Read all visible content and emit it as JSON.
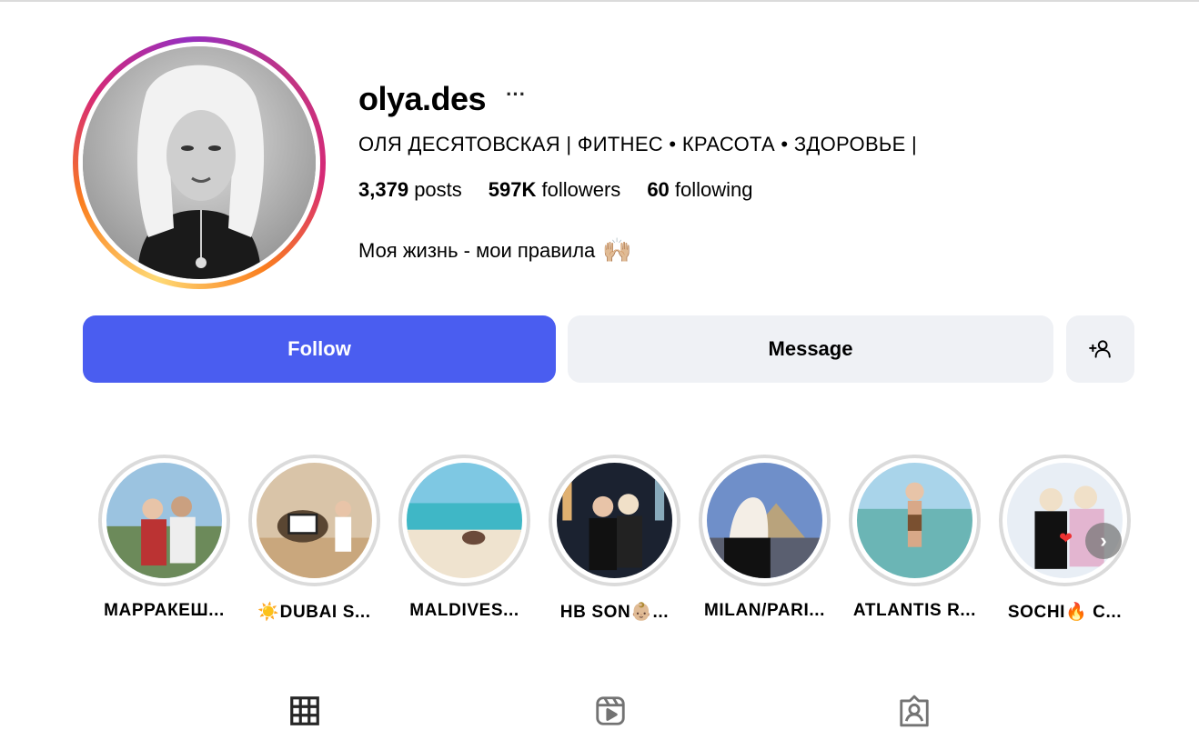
{
  "profile": {
    "username": "olya.des",
    "more_label": "···",
    "full_name": "ОЛЯ ДЕСЯТОВСКАЯ | ФИТНЕС • КРАСОТА • ЗДОРОВЬЕ |",
    "stats": {
      "posts_count": "3,379",
      "posts_label": "posts",
      "followers_count": "597K",
      "followers_label": "followers",
      "following_count": "60",
      "following_label": "following"
    },
    "bio_text": "Моя жизнь - мои правила",
    "bio_emoji": "🙌🏼"
  },
  "actions": {
    "follow_label": "Follow",
    "message_label": "Message",
    "suggest_icon": "add-person-icon"
  },
  "highlights": [
    {
      "label": "МАРРАКЕШ..."
    },
    {
      "label": "☀️DUBAI S..."
    },
    {
      "label": "MALDIVES..."
    },
    {
      "label": "HB SON👶🏼..."
    },
    {
      "label": "MILAN/PARI..."
    },
    {
      "label": "ATLANTIS R..."
    },
    {
      "label": "SOCHI🔥 C..."
    }
  ],
  "highlights_next_icon": "chevron-right-icon",
  "tabs": [
    {
      "icon": "grid-icon"
    },
    {
      "icon": "reels-icon"
    },
    {
      "icon": "tagged-icon"
    }
  ],
  "colors": {
    "follow_button": "#4a5df0",
    "secondary_button": "#eff1f5",
    "highlight_ring": "#dbdbdb"
  }
}
